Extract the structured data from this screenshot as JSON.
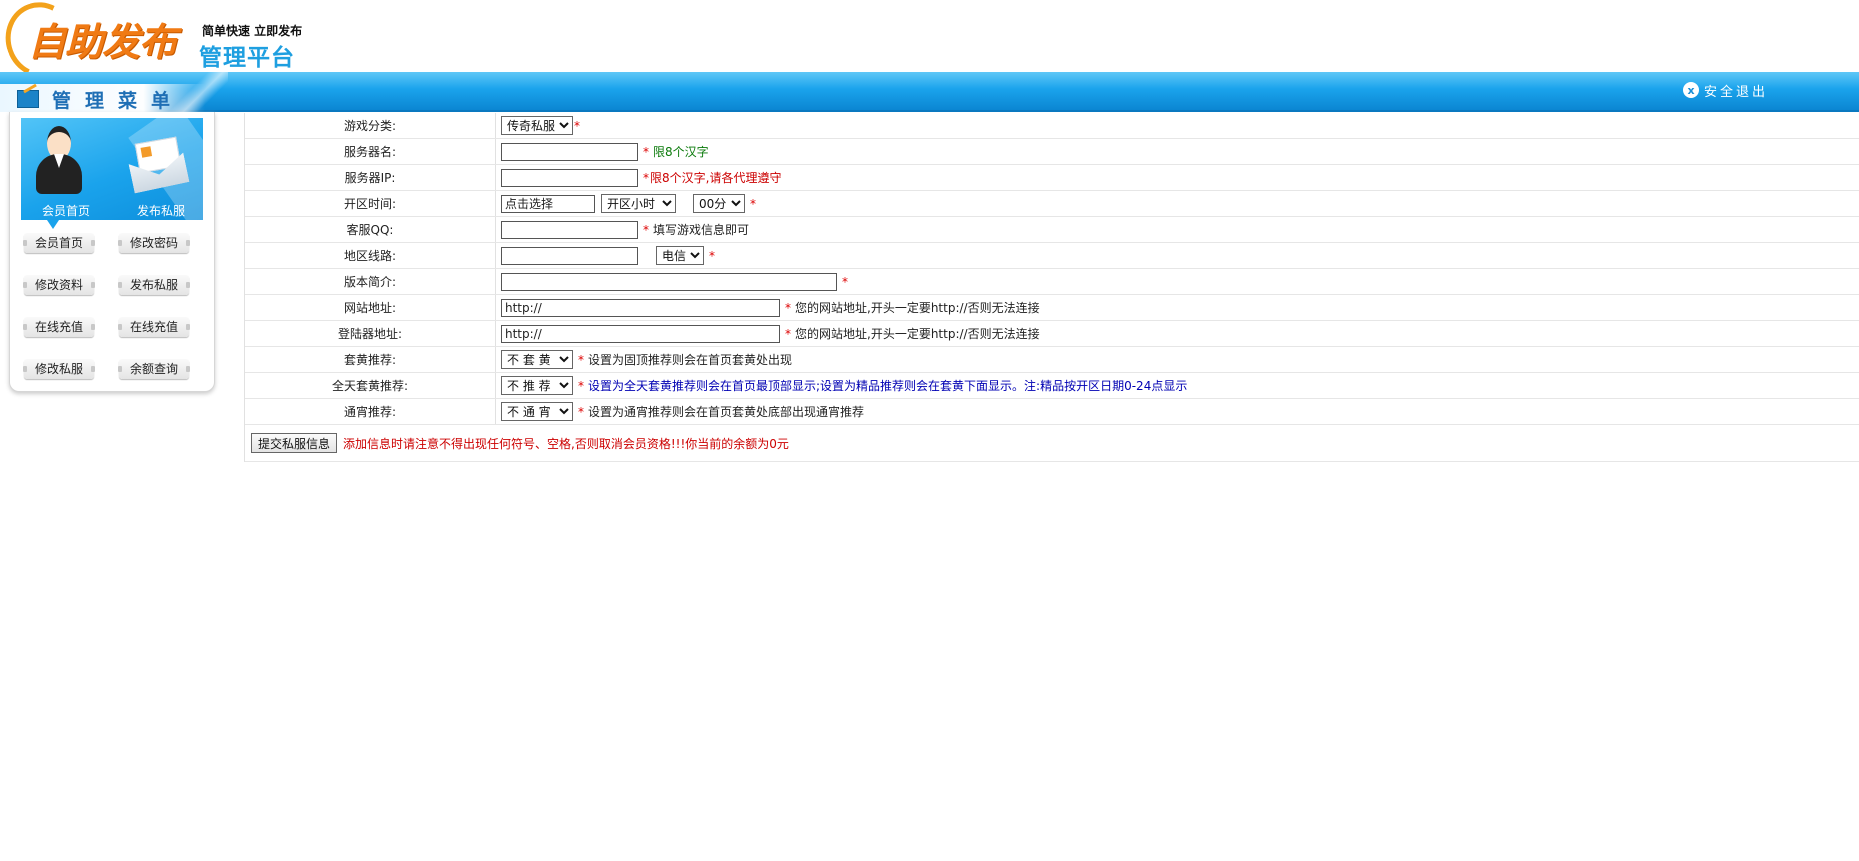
{
  "header": {
    "logo_main": "自助发布",
    "logo_tagline": "简单快速 立即发布",
    "logo_platform": "管理平台",
    "menu_title": "管理菜单",
    "logout_label": "安全退出",
    "logout_icon": "x"
  },
  "sidebar": {
    "banner_labels": {
      "member_home": "会员首页",
      "publish": "发布私服"
    },
    "buttons": [
      "会员首页",
      "修改密码",
      "修改资料",
      "发布私服",
      "在线充值",
      "在线充值",
      "修改私服",
      "余额查询"
    ]
  },
  "form": {
    "category": {
      "label": "游戏分类:",
      "selected": "传奇私服"
    },
    "server_name": {
      "label": "服务器名:",
      "value": "",
      "hint": "限8个汉字"
    },
    "server_ip": {
      "label": "服务器IP:",
      "value": "",
      "hint": "限8个汉字,请各代理遵守"
    },
    "open_time": {
      "label": "开区时间:",
      "date_value": "点击选择",
      "hour_selected": "开区小时",
      "minute_selected": "00分"
    },
    "qq": {
      "label": "客服QQ:",
      "value": "",
      "hint": "填写游戏信息即可"
    },
    "line": {
      "label": "地区线路:",
      "value": "",
      "selected": "电信"
    },
    "intro": {
      "label": "版本简介:",
      "value": ""
    },
    "website": {
      "label": "网站地址:",
      "value": "http://",
      "hint": "您的网站地址,开头一定要http://否则无法连接"
    },
    "launcher": {
      "label": "登陆器地址:",
      "value": "http://",
      "hint": "您的网站地址,开头一定要http://否则无法连接"
    },
    "top_recommend": {
      "label": "套黄推荐:",
      "selected": "不 套 黄",
      "hint": "设置为固顶推荐则会在首页套黄处出现"
    },
    "allday_recommend": {
      "label": "全天套黄推荐:",
      "selected": "不 推 荐",
      "hint": "设置为全天套黄推荐则会在首页最顶部显示;设置为精品推荐则会在套黄下面显示。注:精品按开区日期0-24点显示"
    },
    "normal_recommend": {
      "label": "通宵推荐:",
      "selected": "不 通 宵",
      "hint": "设置为通宵推荐则会在首页套黄处底部出现通宵推荐"
    },
    "submit_label": "提交私服信息",
    "submit_note": "添加信息时请注意不得出现任何符号、空格,否则取消会员资格!!!你当前的余额为0元",
    "required_mark": "*"
  }
}
